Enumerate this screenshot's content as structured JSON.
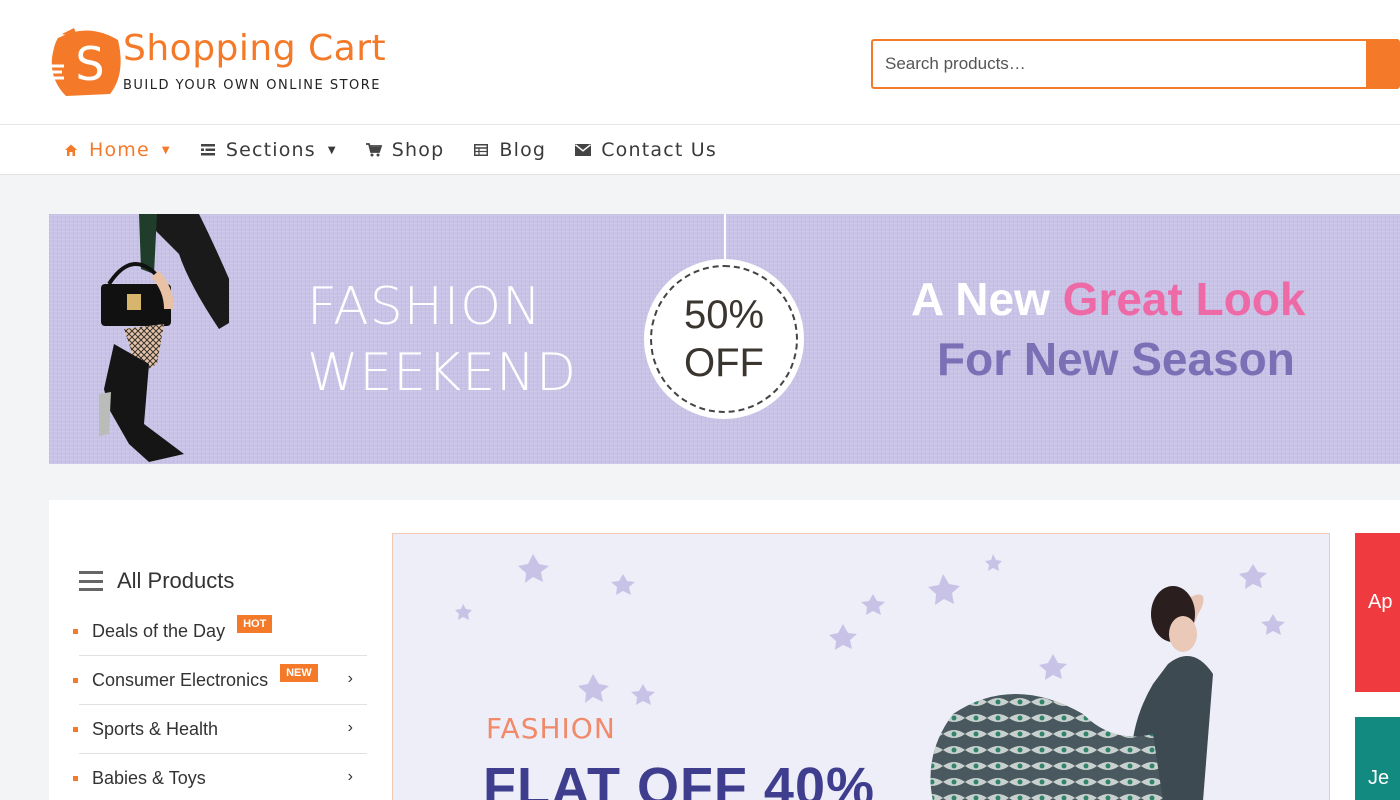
{
  "brand": {
    "name": "Shopping Cart",
    "tagline": "BUILD YOUR OWN ONLINE STORE",
    "badge_letter": "S",
    "color": "#f47a2a"
  },
  "search": {
    "placeholder": "Search products…"
  },
  "nav": {
    "items": [
      {
        "label": "Home",
        "icon": "home-icon",
        "has_dropdown": true,
        "active": true
      },
      {
        "label": "Sections",
        "icon": "sections-icon",
        "has_dropdown": true,
        "active": false
      },
      {
        "label": "Shop",
        "icon": "cart-icon",
        "has_dropdown": false,
        "active": false
      },
      {
        "label": "Blog",
        "icon": "blog-icon",
        "has_dropdown": false,
        "active": false
      },
      {
        "label": "Contact Us",
        "icon": "envelope-icon",
        "has_dropdown": false,
        "active": false
      }
    ]
  },
  "promo": {
    "fashion_line1": "FASHION",
    "fashion_line2": "WEEKEND",
    "discount_value": "50%",
    "discount_label": "OFF",
    "headline_prefix": "A New",
    "headline_highlight": "Great Look",
    "headline_line2": "For New Season"
  },
  "categories": {
    "title": "All Products",
    "items": [
      {
        "label": "Deals of the Day",
        "badge": "HOT",
        "has_arrow": false
      },
      {
        "label": "Consumer Electronics",
        "badge": "NEW",
        "has_arrow": true
      },
      {
        "label": "Sports & Health",
        "badge": "",
        "has_arrow": true
      },
      {
        "label": "Babies & Toys",
        "badge": "",
        "has_arrow": true
      }
    ]
  },
  "slide": {
    "kicker": "FASHION",
    "headline": "FLAT OFF 40%"
  },
  "side_tiles": [
    {
      "label": "Ap",
      "color": "#ef3b3f"
    },
    {
      "label": "Je",
      "color": "#128a7f"
    }
  ]
}
